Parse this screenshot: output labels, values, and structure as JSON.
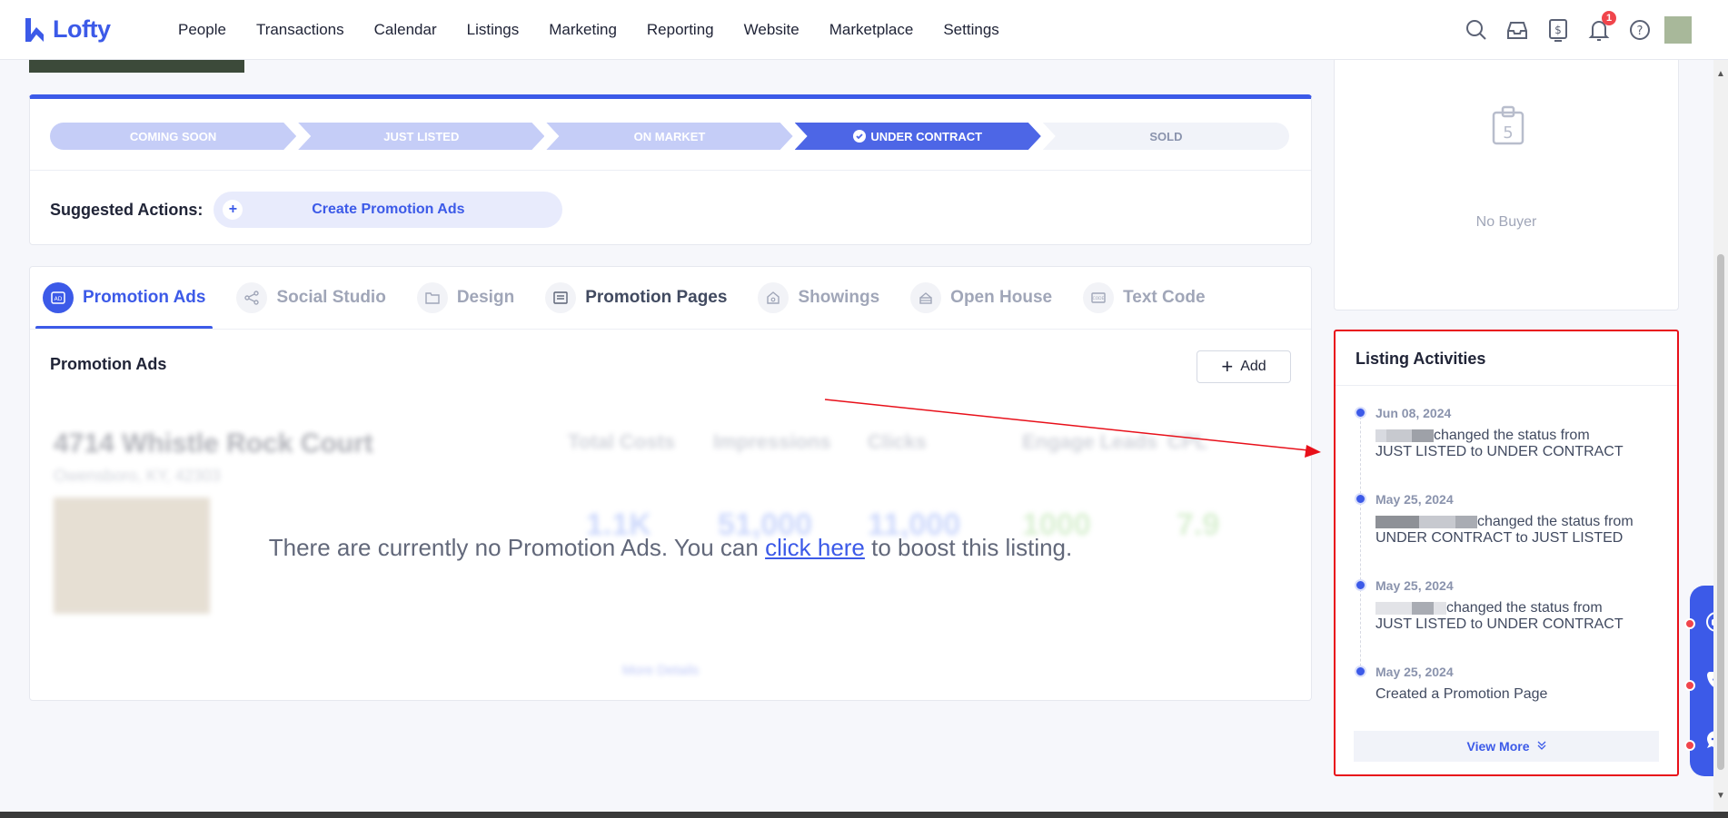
{
  "app": {
    "logo_text": "Lofty"
  },
  "nav": {
    "links": [
      "People",
      "Transactions",
      "Calendar",
      "Listings",
      "Marketing",
      "Reporting",
      "Website",
      "Marketplace",
      "Settings"
    ],
    "notification_count": "1"
  },
  "status_steps": {
    "items": [
      "COMING SOON",
      "JUST LISTED",
      "ON MARKET",
      "UNDER CONTRACT",
      "SOLD"
    ],
    "active": "UNDER CONTRACT"
  },
  "suggested": {
    "label": "Suggested Actions:",
    "button": "Create Promotion Ads",
    "plus": "+"
  },
  "tabs": [
    "Promotion Ads",
    "Social Studio",
    "Design",
    "Promotion Pages",
    "Showings",
    "Open House",
    "Text Code"
  ],
  "promotion_ads": {
    "title": "Promotion Ads",
    "add_label": "Add",
    "empty_before": "There are currently no Promotion Ads. You can ",
    "empty_link": "click here",
    "empty_after": " to boost this listing.",
    "blurred": {
      "address": "4714 Whistle Rock Court",
      "city": "Owensboro, KY, 42303",
      "metrics": [
        "Total Costs",
        "Impressions",
        "Clicks",
        "Engage Leads",
        "CPL"
      ],
      "values": [
        "1.1K",
        "51,000",
        "11,000",
        "1000",
        "7.9"
      ],
      "more": "More Details"
    }
  },
  "buyer": {
    "empty_text": "No Buyer"
  },
  "activities": {
    "title": "Listing Activities",
    "items": [
      {
        "date": "Jun 08, 2024",
        "line1": "changed the status from",
        "line2": "JUST LISTED to UNDER CONTRACT"
      },
      {
        "date": "May 25, 2024",
        "line1": "changed the status from",
        "line2": "UNDER CONTRACT to JUST LISTED"
      },
      {
        "date": "May 25, 2024",
        "line1": "changed the status from",
        "line2": "JUST LISTED to UNDER CONTRACT"
      },
      {
        "date": "May 25, 2024",
        "line1": "Created a Promotion Page",
        "line2": ""
      }
    ],
    "view_more": "View More"
  },
  "colors": {
    "accent": "#3c5ae8",
    "highlight": "#e8101a",
    "badge": "#f0454c"
  }
}
